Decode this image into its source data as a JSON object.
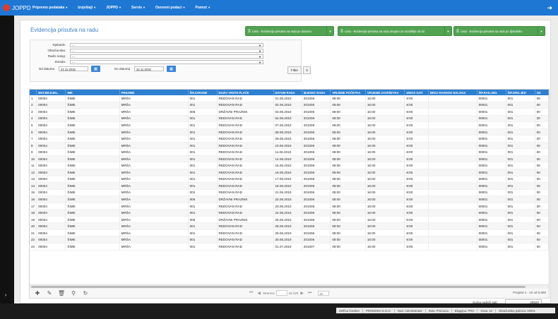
{
  "app": {
    "logo_text": "JOPPD"
  },
  "menu": [
    {
      "label": "Pripremo podataka"
    },
    {
      "label": "Izvještaji"
    },
    {
      "label": "JOPPD"
    },
    {
      "label": "Servis"
    },
    {
      "label": "Osnovni podaci"
    },
    {
      "label": "Pomoć"
    }
  ],
  "page": {
    "title": "Evidencija prisutva na radu"
  },
  "actions": [
    {
      "label": "Lista - Evidencija prisutva na radu po datuma"
    },
    {
      "label": "Lista - Evidencija prisutva na radu ukupno za razdoblje od do"
    },
    {
      "label": "Lista - Evidencija prisutva na radu po djelatniku"
    }
  ],
  "filters": {
    "djelatnik_label": "Djelatnik:",
    "djelatnik_value": "- -",
    "obracunska_label": "Obračunska:",
    "obracunska_value": "- -",
    "radni_nalog_label": "Radni nalog:",
    "radni_nalog_value": "- -",
    "zarada_label": "Zarada:",
    "zarada_value": "- -",
    "od_datuma_label": "Od datuma",
    "od_datuma_value": "22.11.2018",
    "do_datuma_label": "Do datuma",
    "do_datuma_value": "22.11.2018",
    "filter_btn": "Filter",
    "clear_btn": "X"
  },
  "grid": {
    "columns": [
      "MAT.BR.DJEL.",
      "IME",
      "PREZIME",
      "ŠIF.ZARADE",
      "NAZIV VRSTE PLAĆE",
      "DATUM RADA",
      "MJESEC RADA",
      "VRIJEME POČETKA",
      "VRIJEME ZAVRŠETKA",
      "IZNOS SATI",
      "BROJ RADNOG NALOGA",
      "ŠIF.RAD.JED.",
      "ŠIF.ORG.JED",
      "OZ"
    ],
    "rows": [
      [
        "1",
        "00004",
        "ŠIME",
        "MRŠA",
        "001",
        "REDOVAN RAD",
        "01.06.2010",
        "201006",
        "08:00",
        "16:00",
        "8:00",
        "",
        "00001",
        "001",
        "00"
      ],
      [
        "2",
        "00004",
        "ŠIME",
        "MRŠA",
        "001",
        "REDOVAN RAD",
        "02.06.2010",
        "201006",
        "08:00",
        "16:00",
        "8:00",
        "",
        "00001",
        "001",
        "00"
      ],
      [
        "3",
        "00004",
        "ŠIME",
        "MRŠA",
        "005",
        "DRŽAVNI PRAZNIK",
        "03.06.2010",
        "201006",
        "08:00",
        "16:00",
        "8:00",
        "",
        "00001",
        "001",
        "00"
      ],
      [
        "4",
        "00004",
        "ŠIME",
        "MRŠA",
        "001",
        "REDOVAN RAD",
        "04.06.2010",
        "201006",
        "08:00",
        "16:00",
        "8:00",
        "",
        "00001",
        "001",
        "00"
      ],
      [
        "5",
        "00004",
        "ŠIME",
        "MRŠA",
        "001",
        "REDOVAN RAD",
        "07.06.2010",
        "201006",
        "08:00",
        "16:00",
        "8:00",
        "",
        "00001",
        "001",
        "00"
      ],
      [
        "6",
        "00004",
        "ŠIME",
        "MRŠA",
        "001",
        "REDOVAN RAD",
        "08.06.2010",
        "201006",
        "08:00",
        "16:00",
        "8:00",
        "",
        "00001",
        "001",
        "00"
      ],
      [
        "7",
        "00004",
        "ŠIME",
        "MRŠA",
        "001",
        "REDOVAN RAD",
        "09.06.2010",
        "201006",
        "08:00",
        "16:00",
        "8:00",
        "",
        "00001",
        "001",
        "00"
      ],
      [
        "8",
        "00004",
        "ŠIME",
        "MRŠA",
        "001",
        "REDOVAN RAD",
        "10.06.2010",
        "201006",
        "08:00",
        "16:00",
        "8:00",
        "",
        "00001",
        "001",
        "00"
      ],
      [
        "9",
        "00004",
        "ŠIME",
        "MRŠA",
        "001",
        "REDOVAN RAD",
        "11.06.2010",
        "201006",
        "08:00",
        "16:00",
        "8:00",
        "",
        "00001",
        "001",
        "00"
      ],
      [
        "10",
        "00004",
        "ŠIME",
        "MRŠA",
        "001",
        "REDOVAN RAD",
        "14.06.2010",
        "201006",
        "08:00",
        "16:00",
        "8:00",
        "",
        "00001",
        "001",
        "00"
      ],
      [
        "11",
        "00004",
        "ŠIME",
        "MRŠA",
        "001",
        "REDOVAN RAD",
        "15.06.2010",
        "201006",
        "08:00",
        "16:00",
        "8:00",
        "",
        "00001",
        "001",
        "00"
      ],
      [
        "12",
        "00004",
        "ŠIME",
        "MRŠA",
        "001",
        "REDOVAN RAD",
        "16.06.2010",
        "201006",
        "08:00",
        "16:00",
        "8:00",
        "",
        "00001",
        "001",
        "00"
      ],
      [
        "13",
        "00004",
        "ŠIME",
        "MRŠA",
        "001",
        "REDOVAN RAD",
        "17.06.2010",
        "201006",
        "08:00",
        "16:00",
        "8:00",
        "",
        "00001",
        "001",
        "00"
      ],
      [
        "14",
        "00004",
        "ŠIME",
        "MRŠA",
        "001",
        "REDOVAN RAD",
        "18.06.2010",
        "201006",
        "08:00",
        "16:00",
        "8:00",
        "",
        "00001",
        "001",
        "00"
      ],
      [
        "15",
        "00004",
        "ŠIME",
        "MRŠA",
        "001",
        "REDOVAN RAD",
        "21.06.2010",
        "201006",
        "08:00",
        "16:00",
        "8:00",
        "",
        "00001",
        "001",
        "00"
      ],
      [
        "16",
        "00004",
        "ŠIME",
        "MRŠA",
        "005",
        "DRŽAVNI PRAZNIK",
        "22.06.2010",
        "201006",
        "08:00",
        "16:00",
        "8:00",
        "",
        "00001",
        "001",
        "00"
      ],
      [
        "17",
        "00004",
        "ŠIME",
        "MRŠA",
        "001",
        "REDOVAN RAD",
        "23.06.2010",
        "201006",
        "08:00",
        "16:00",
        "8:00",
        "",
        "00001",
        "001",
        "00"
      ],
      [
        "18",
        "00004",
        "ŠIME",
        "MRŠA",
        "001",
        "REDOVAN RAD",
        "24.06.2010",
        "201006",
        "08:00",
        "16:00",
        "8:00",
        "",
        "00001",
        "001",
        "00"
      ],
      [
        "19",
        "00004",
        "ŠIME",
        "MRŠA",
        "005",
        "DRŽAVNI PRAZNIK",
        "25.06.2010",
        "201006",
        "08:00",
        "16:00",
        "8:00",
        "",
        "00001",
        "001",
        "00"
      ],
      [
        "20",
        "00004",
        "ŠIME",
        "MRŠA",
        "001",
        "REDOVAN RAD",
        "28.06.2010",
        "201006",
        "08:00",
        "16:00",
        "8:00",
        "",
        "00001",
        "001",
        "00"
      ],
      [
        "21",
        "00004",
        "ŠIME",
        "MRŠA",
        "001",
        "REDOVAN RAD",
        "29.06.2010",
        "201006",
        "08:00",
        "16:00",
        "8:00",
        "",
        "00001",
        "001",
        "00"
      ],
      [
        "22",
        "00004",
        "ŠIME",
        "MRŠA",
        "001",
        "REDOVAN RAD",
        "30.06.2010",
        "201006",
        "08:00",
        "16:00",
        "8:00",
        "",
        "00001",
        "001",
        "00"
      ],
      [
        "23",
        "00004",
        "ŠIME",
        "MRŠA",
        "001",
        "REDOVAN RAD",
        "01.07.2010",
        "201007",
        "08:00",
        "16:00",
        "8:00",
        "",
        "00001",
        "001",
        "00"
      ]
    ]
  },
  "pager": {
    "page_label": "Stranica",
    "of_label": "od 225",
    "rows_per_page": "25",
    "info": "Pregled 1 - 23 od 5.665"
  },
  "summary": {
    "label": "Suma radnih sati:",
    "value": "40520"
  },
  "status": [
    "Delfina Čamber",
    "PROMONA D.O.O.",
    "Novi: Administrator",
    "Rola: Promona",
    "Blagajna: PRO",
    "Kasa: 10",
    "Obračunska jedinica: 00001"
  ]
}
